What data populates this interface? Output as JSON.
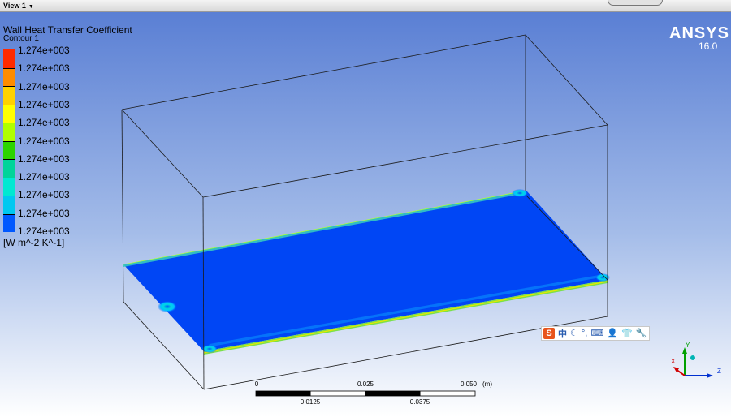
{
  "window": {
    "view_tab_label": "View 1"
  },
  "legend": {
    "title": "Wall Heat Transfer Coefficient",
    "contour_name": "Contour 1",
    "values": [
      "1.274e+003",
      "1.274e+003",
      "1.274e+003",
      "1.274e+003",
      "1.274e+003",
      "1.274e+003",
      "1.274e+003",
      "1.274e+003",
      "1.274e+003",
      "1.274e+003",
      "1.274e+003"
    ],
    "colors": [
      "#ff2a00",
      "#ff8c00",
      "#ffd200",
      "#ffff00",
      "#b0ff00",
      "#2cd400",
      "#00d49a",
      "#00e8d2",
      "#00c8f0",
      "#0058ff"
    ],
    "units": "[W m^-2 K^-1]"
  },
  "brand": {
    "name": "ANSYS",
    "version": "16.0"
  },
  "scale_bar": {
    "top_labels": [
      "0",
      "0.025",
      "0.050"
    ],
    "bottom_labels": [
      "0.0125",
      "0.0375"
    ],
    "unit": "(m)"
  },
  "axes_triad": {
    "x_label": "X",
    "y_label": "Y",
    "z_label": "Z",
    "x_color": "#d00000",
    "y_color": "#00a000",
    "z_color": "#0030d0"
  },
  "ime_toolbar": {
    "logo": "S",
    "mode": "中",
    "icons": [
      "moon-icon",
      "punctuation-icon",
      "keyboard-icon",
      "user-icon",
      "shirt-icon",
      "wrench-icon"
    ]
  }
}
